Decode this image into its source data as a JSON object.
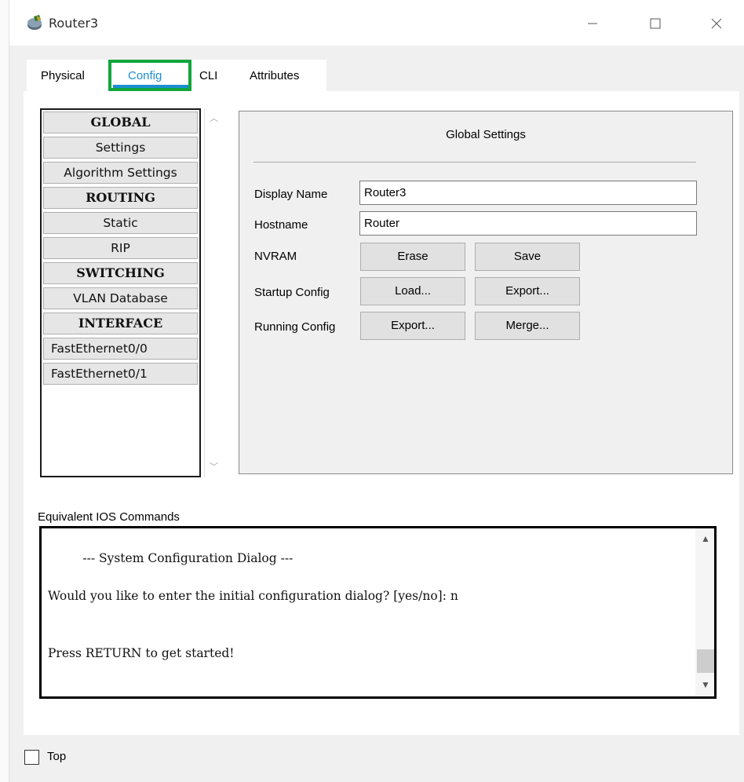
{
  "window": {
    "title": "Router3"
  },
  "tabs": [
    {
      "label": "Physical"
    },
    {
      "label": "Config"
    },
    {
      "label": "CLI"
    },
    {
      "label": "Attributes"
    }
  ],
  "nav": {
    "items": [
      {
        "label": "GLOBAL"
      },
      {
        "label": "Settings"
      },
      {
        "label": "Algorithm Settings"
      },
      {
        "label": "ROUTING"
      },
      {
        "label": "Static"
      },
      {
        "label": "RIP"
      },
      {
        "label": "SWITCHING"
      },
      {
        "label": "VLAN Database"
      },
      {
        "label": "INTERFACE"
      },
      {
        "label": "FastEthernet0/0"
      },
      {
        "label": "FastEthernet0/1"
      }
    ]
  },
  "global_settings": {
    "title": "Global Settings",
    "display_name_label": "Display Name",
    "display_name_value": "Router3",
    "hostname_label": "Hostname",
    "hostname_value": "Router",
    "nvram_label": "NVRAM",
    "erase_button": "Erase",
    "save_button": "Save",
    "startup_label": "Startup Config",
    "load_button": "Load...",
    "startup_export_button": "Export...",
    "running_label": "Running Config",
    "running_export_button": "Export...",
    "merge_button": "Merge..."
  },
  "ios": {
    "label": "Equivalent IOS Commands",
    "lines": [
      "         --- System Configuration Dialog ---",
      "Would you like to enter the initial configuration dialog? [yes/no]: n",
      "Press RETURN to get started!"
    ]
  },
  "bottom": {
    "top_label": "Top",
    "top_checked": false
  },
  "colors": {
    "active_tab": "#1c8fd1",
    "highlight_box": "#12a53c"
  }
}
